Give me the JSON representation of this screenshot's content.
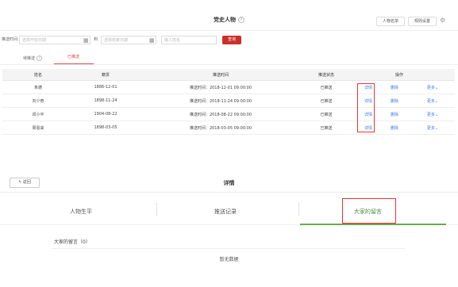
{
  "header": {
    "title": "党史人物",
    "help_icon": "?",
    "people_list_btn": "人物名单",
    "rules_btn": "规则设置",
    "gear_icon": "⚙"
  },
  "filter": {
    "push_time_label": "推送时间:",
    "start_placeholder": "选择开始日期",
    "to_label": "到",
    "end_placeholder": "选择结束日期",
    "name_placeholder": "输入姓名",
    "query_btn": "查询"
  },
  "tabs": {
    "pending": "待推送",
    "pending_help": "?",
    "sent": "已推送"
  },
  "table": {
    "headers": {
      "name": "姓名",
      "birth": "籍贯",
      "time": "推送时间",
      "status": "推送状态",
      "ops": "操作"
    },
    "rows": [
      {
        "name": "朱德",
        "birth": "1886-12-01",
        "time": "推送时间：2018-12-01 09:00:00",
        "status": "已推送",
        "detail": "详情",
        "delete": "删除",
        "more": "更多⌄"
      },
      {
        "name": "刘少奇",
        "birth": "1898-11-24",
        "time": "推送时间：2018-11-24 09:00:00",
        "status": "已推送",
        "detail": "详情",
        "delete": "删除",
        "more": "更多⌄"
      },
      {
        "name": "邓小平",
        "birth": "1904-08-22",
        "time": "推送时间：2018-08-22 09:00:00",
        "status": "已推送",
        "detail": "详情",
        "delete": "删除",
        "more": "更多⌄"
      },
      {
        "name": "周恩来",
        "birth": "1898-03-05",
        "time": "推送时间：2018-03-05 09:00:00",
        "status": "已推送",
        "detail": "详情",
        "delete": "删除",
        "more": "更多⌄"
      }
    ]
  },
  "detail": {
    "back_btn": "返回",
    "back_icon": "↰",
    "title": "详情",
    "tabs": {
      "bio": "人物生平",
      "log": "推送记录",
      "messages": "大家的留言"
    },
    "messages_count": "大家的留言（0）",
    "no_data": "暂无数据"
  },
  "colors": {
    "accent_red": "#c9302c",
    "link_blue": "#3a7ee6",
    "active_green": "#6aa84f",
    "highlight_red": "#ee3333"
  }
}
